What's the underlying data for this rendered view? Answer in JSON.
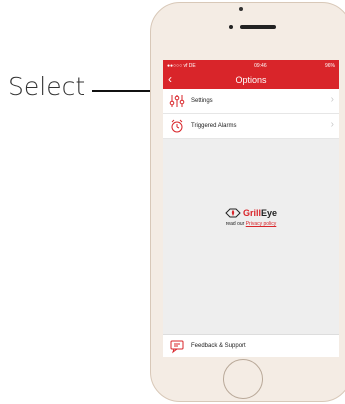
{
  "annotation": {
    "label": "Select"
  },
  "statusbar": {
    "carrier": "●●○○○ vf DE",
    "time": "09:46",
    "battery": "96%"
  },
  "navbar": {
    "title": "Options",
    "back_icon": "chevron-left-icon"
  },
  "menu": [
    {
      "label": "Settings",
      "icon": "sliders-icon"
    },
    {
      "label": "Triggered Alarms",
      "icon": "alarm-icon"
    }
  ],
  "logo": {
    "brand_prefix": "Grill",
    "brand_suffix": "Eye"
  },
  "privacy": {
    "prefix": "read our",
    "link": "Privacy policy"
  },
  "footer": {
    "label": "Feedback & Support",
    "icon": "chat-icon"
  },
  "colors": {
    "accent": "#d9252a",
    "background": "#eeeeee"
  }
}
